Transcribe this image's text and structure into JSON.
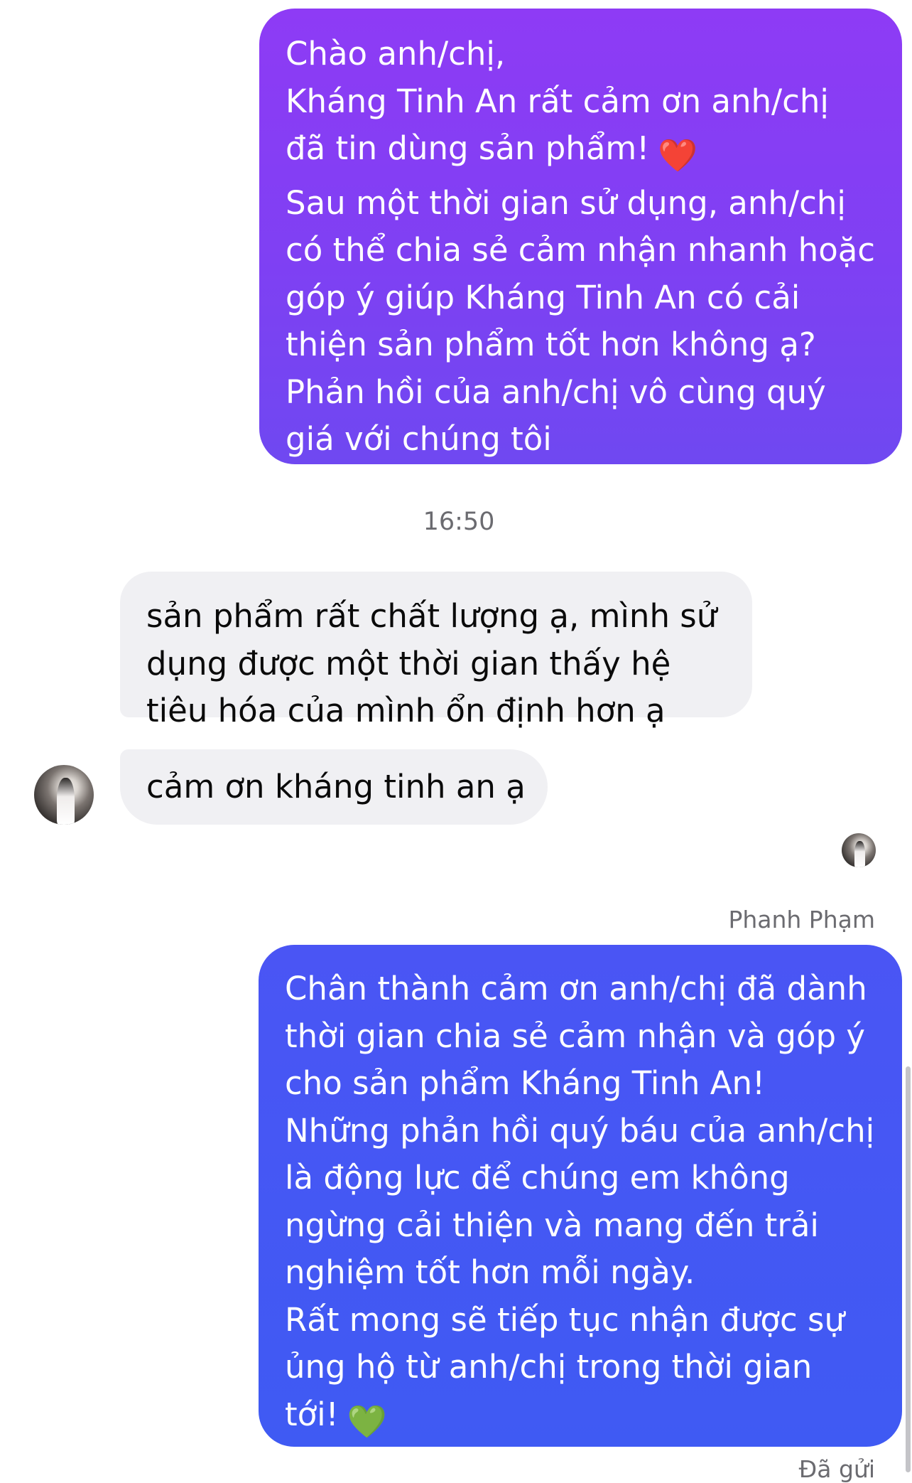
{
  "messages": [
    {
      "direction": "outgoing",
      "text": "Chào anh/chị,\nKháng Tinh An rất cảm ơn anh/chị\nđã tin dùng sản phẩm!",
      "emoji": "❤️",
      "continued": "\nSau một thời gian sử dụng, anh/chị\ncó thể chia sẻ cảm nhận nhanh hoặc\ngóp ý giúp Kháng Tinh An có cải\nthiện sản phẩm tốt hơn không ạ?\nPhản hồi của anh/chị vô cùng quý\ngiá với chúng tôi"
    },
    {
      "direction": "incoming",
      "text": "sản phẩm rất chất lượng ạ, mình sử\ndụng được một thời gian thấy hệ\ntiêu hóa của mình ổn định hơn ạ"
    },
    {
      "direction": "incoming",
      "text": "cảm ơn kháng tinh an ạ"
    },
    {
      "direction": "outgoing",
      "text": "Chân thành cảm ơn anh/chị đã dành\nthời gian chia sẻ cảm nhận và góp ý\ncho sản phẩm Kháng Tinh An!\nNhững phản hồi quý báu của anh/chị\nlà động lực để chúng em không\nngừng cải thiện và mang đến trải\nnghiệm tốt hơn mỗi ngày.\nRất mong sẽ tiếp tục nhận được sự\nủng hộ từ anh/chị trong thời gian\ntới!",
      "emoji": "💚"
    }
  ],
  "timestamp": "16:50",
  "sender_name": "Phanh Phạm",
  "status": "Đã gửi",
  "colors": {
    "outgoing_purple": "#8e3bf5",
    "outgoing_blue": "#4a55f4",
    "incoming_bg": "#f0f0f3",
    "meta_text": "#6b6b70"
  }
}
